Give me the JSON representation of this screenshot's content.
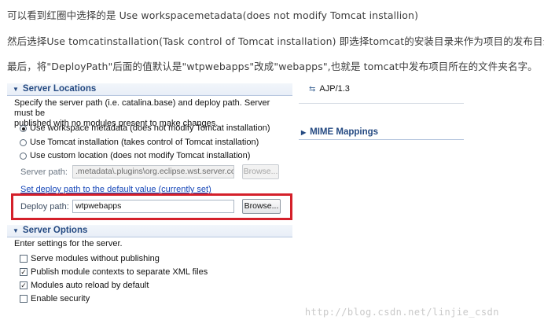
{
  "paragraphs": [
    "可以看到红圈中选择的是 Use workspacemetadata(does not modify Tomcat installion)",
    "然后选择Use tomcatinstallation(Task control of Tomcat installation) 即选择tomcat的安装目录来作为项目的发布目录。",
    "最后，将\"DeployPath\"后面的值默认是\"wtpwebapps\"改成\"webapps\",也就是 tomcat中发布项目所在的文件夹名字。"
  ],
  "server_locations": {
    "title": "Server Locations",
    "description_line1": "Specify the server path (i.e. catalina.base) and deploy path. Server must be",
    "description_line2": "published with no modules present to make changes.",
    "options": [
      {
        "label": "Use workspace metadata (does not modify Tomcat installation)",
        "selected": true
      },
      {
        "label": "Use Tomcat installation (takes control of Tomcat installation)",
        "selected": false
      },
      {
        "label": "Use custom location (does not modify Tomcat installation)",
        "selected": false
      }
    ],
    "server_path_label": "Server path:",
    "server_path_value": ".metadata\\.plugins\\org.eclipse.wst.server.cor",
    "browse_label": "Browse...",
    "set_default_link": "Set deploy path to the default value (currently set)",
    "deploy_path_label": "Deploy path:",
    "deploy_path_value": "wtpwebapps",
    "deploy_browse_label": "Browse..."
  },
  "server_options": {
    "title": "Server Options",
    "description": "Enter settings for the server.",
    "checkboxes": [
      {
        "label": "Serve modules without publishing",
        "checked": false
      },
      {
        "label": "Publish module contexts to separate XML files",
        "checked": true
      },
      {
        "label": "Modules auto reload by default",
        "checked": true
      },
      {
        "label": "Enable security",
        "checked": false
      }
    ]
  },
  "right_panel": {
    "ajp_label": "AJP/1.3",
    "mime_title": "MIME Mappings"
  },
  "watermark": "http://blog.csdn.net/linjie_csdn",
  "colors": {
    "section_header": "#254a82",
    "link": "#1747b8",
    "highlight_box": "#d4202a"
  }
}
